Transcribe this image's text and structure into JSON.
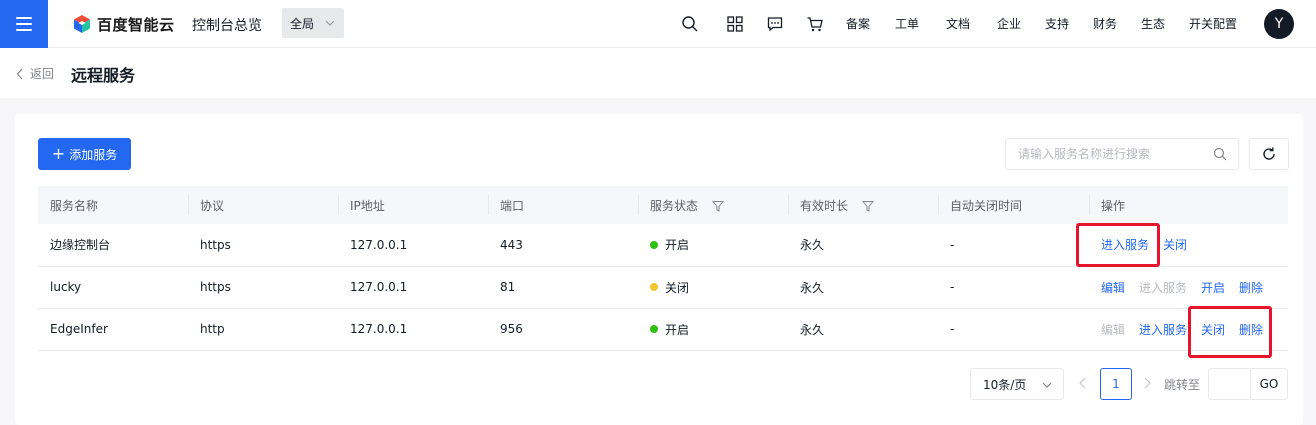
{
  "nav": {
    "brand": "百度智能云",
    "console_title": "控制台总览",
    "region": "全局",
    "links": [
      "备案",
      "工单",
      "文档",
      "企业",
      "支持",
      "财务",
      "生态",
      "开关配置"
    ],
    "avatar_initial": "Y"
  },
  "header": {
    "back_label": "返回",
    "title": "远程服务"
  },
  "toolbar": {
    "add_label": "添加服务",
    "search_placeholder": "请输入服务名称进行搜索"
  },
  "table": {
    "columns": [
      "服务名称",
      "协议",
      "IP地址",
      "端口",
      "服务状态",
      "有效时长",
      "自动关闭时间",
      "操作"
    ],
    "rows": [
      {
        "name": "边缘控制台",
        "protocol": "https",
        "ip": "127.0.0.1",
        "port": "443",
        "status": "开启",
        "status_color": "#30bf13",
        "duration": "永久",
        "auto_close": "-",
        "actions": [
          {
            "label": "进入服务",
            "enabled": true
          },
          {
            "label": "关闭",
            "enabled": true
          }
        ]
      },
      {
        "name": "lucky",
        "protocol": "https",
        "ip": "127.0.0.1",
        "port": "81",
        "status": "关闭",
        "status_color": "#f5c431",
        "duration": "永久",
        "auto_close": "-",
        "actions": [
          {
            "label": "编辑",
            "enabled": true
          },
          {
            "label": "进入服务",
            "enabled": false
          },
          {
            "label": "开启",
            "enabled": true
          },
          {
            "label": "删除",
            "enabled": true
          }
        ]
      },
      {
        "name": "EdgeInfer",
        "protocol": "http",
        "ip": "127.0.0.1",
        "port": "956",
        "status": "开启",
        "status_color": "#30bf13",
        "duration": "永久",
        "auto_close": "-",
        "actions": [
          {
            "label": "编辑",
            "enabled": false
          },
          {
            "label": "进入服务",
            "enabled": true
          },
          {
            "label": "关闭",
            "enabled": true
          },
          {
            "label": "删除",
            "enabled": true
          }
        ]
      }
    ]
  },
  "pagination": {
    "page_size_label": "10条/页",
    "current_page": "1",
    "jump_label": "跳转至",
    "go_label": "GO"
  },
  "colors": {
    "primary": "#2468f2",
    "highlight": "#e8132c"
  }
}
